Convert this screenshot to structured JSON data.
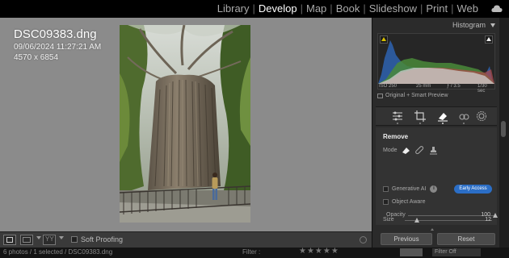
{
  "modules": [
    "Library",
    "Develop",
    "Map",
    "Book",
    "Slideshow",
    "Print",
    "Web"
  ],
  "active_module": "Develop",
  "photo_info": {
    "filename": "DSC09383.dng",
    "datetime": "09/06/2024 11:27:21 AM",
    "dimensions": "4570 x 6854"
  },
  "toolbar": {
    "soft_proofing_label": "Soft Proofing"
  },
  "filmstrip": {
    "path_text": "6 photos / 1 selected / DSC09383.dng",
    "filter_label": "Filter :",
    "custom_label": "",
    "filter_dropdown": "Filter Off"
  },
  "histogram": {
    "title": "Histogram",
    "iso": "ISO 250",
    "focal": "25 mm",
    "aperture": "ƒ / 3.5",
    "shutter": "1/30 sec",
    "preview_label": "Original + Smart Preview"
  },
  "remove_panel": {
    "title": "Remove",
    "mode_label": "Mode",
    "generative_ai_label": "Generative AI",
    "early_access_label": "Early Access",
    "object_aware_label": "Object Aware",
    "size_label": "Size",
    "size_value": "12",
    "size_level": 0.1,
    "opacity_label": "Opacity",
    "opacity_value": "100",
    "opacity_level": 1.0
  },
  "buttons": {
    "previous": "Previous",
    "reset": "Reset"
  },
  "colors": {
    "accent_blue": "#2b6ec6",
    "canvas_gray": "#8b8b8b",
    "panel_bg": "#2b2b2b"
  }
}
